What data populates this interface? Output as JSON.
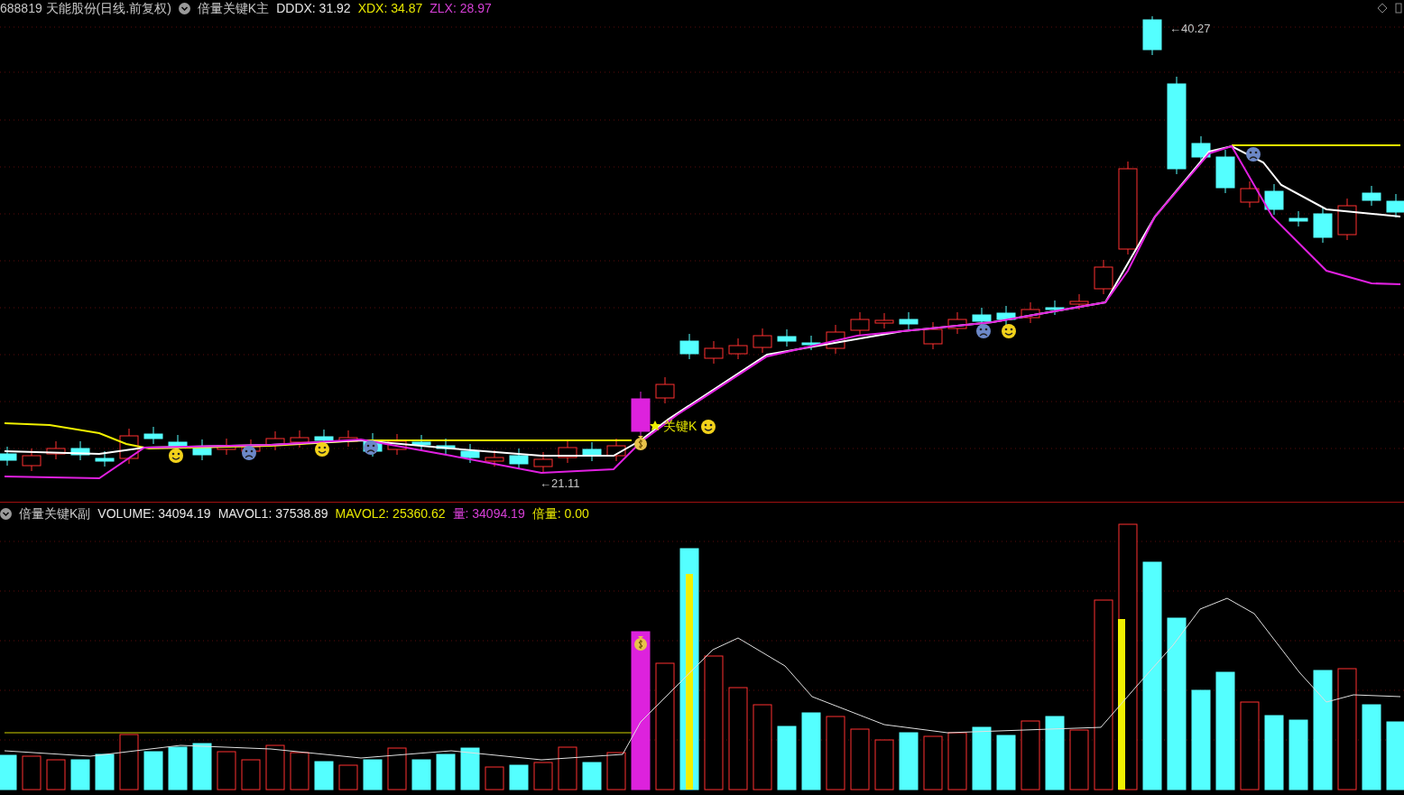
{
  "main_header": {
    "security": "688819 天能股份(日线.前复权)",
    "indicator": "倍量关键K主",
    "values": [
      {
        "text": "DDDX: 31.92",
        "color": "#e6e6e6"
      },
      {
        "text": "XDX: 34.87",
        "color": "#e6e600"
      },
      {
        "text": "ZLX: 28.97",
        "color": "#d63fd6"
      }
    ]
  },
  "main_chart": {
    "high_label": "←40.27",
    "low_label": "←21.11",
    "signal_label": "关键K"
  },
  "volume_header": {
    "indicator": "倍量关键K副",
    "values": [
      {
        "text": "VOLUME: 34094.19",
        "color": "#e6e6e6"
      },
      {
        "text": "MAVOL1: 37538.89",
        "color": "#e6e6e6"
      },
      {
        "text": "MAVOL2: 25360.62",
        "color": "#e6e600"
      },
      {
        "text": "量: 34094.19",
        "color": "#d63fd6"
      },
      {
        "text": "倍量: 0.00",
        "color": "#e6e600"
      }
    ]
  }
}
